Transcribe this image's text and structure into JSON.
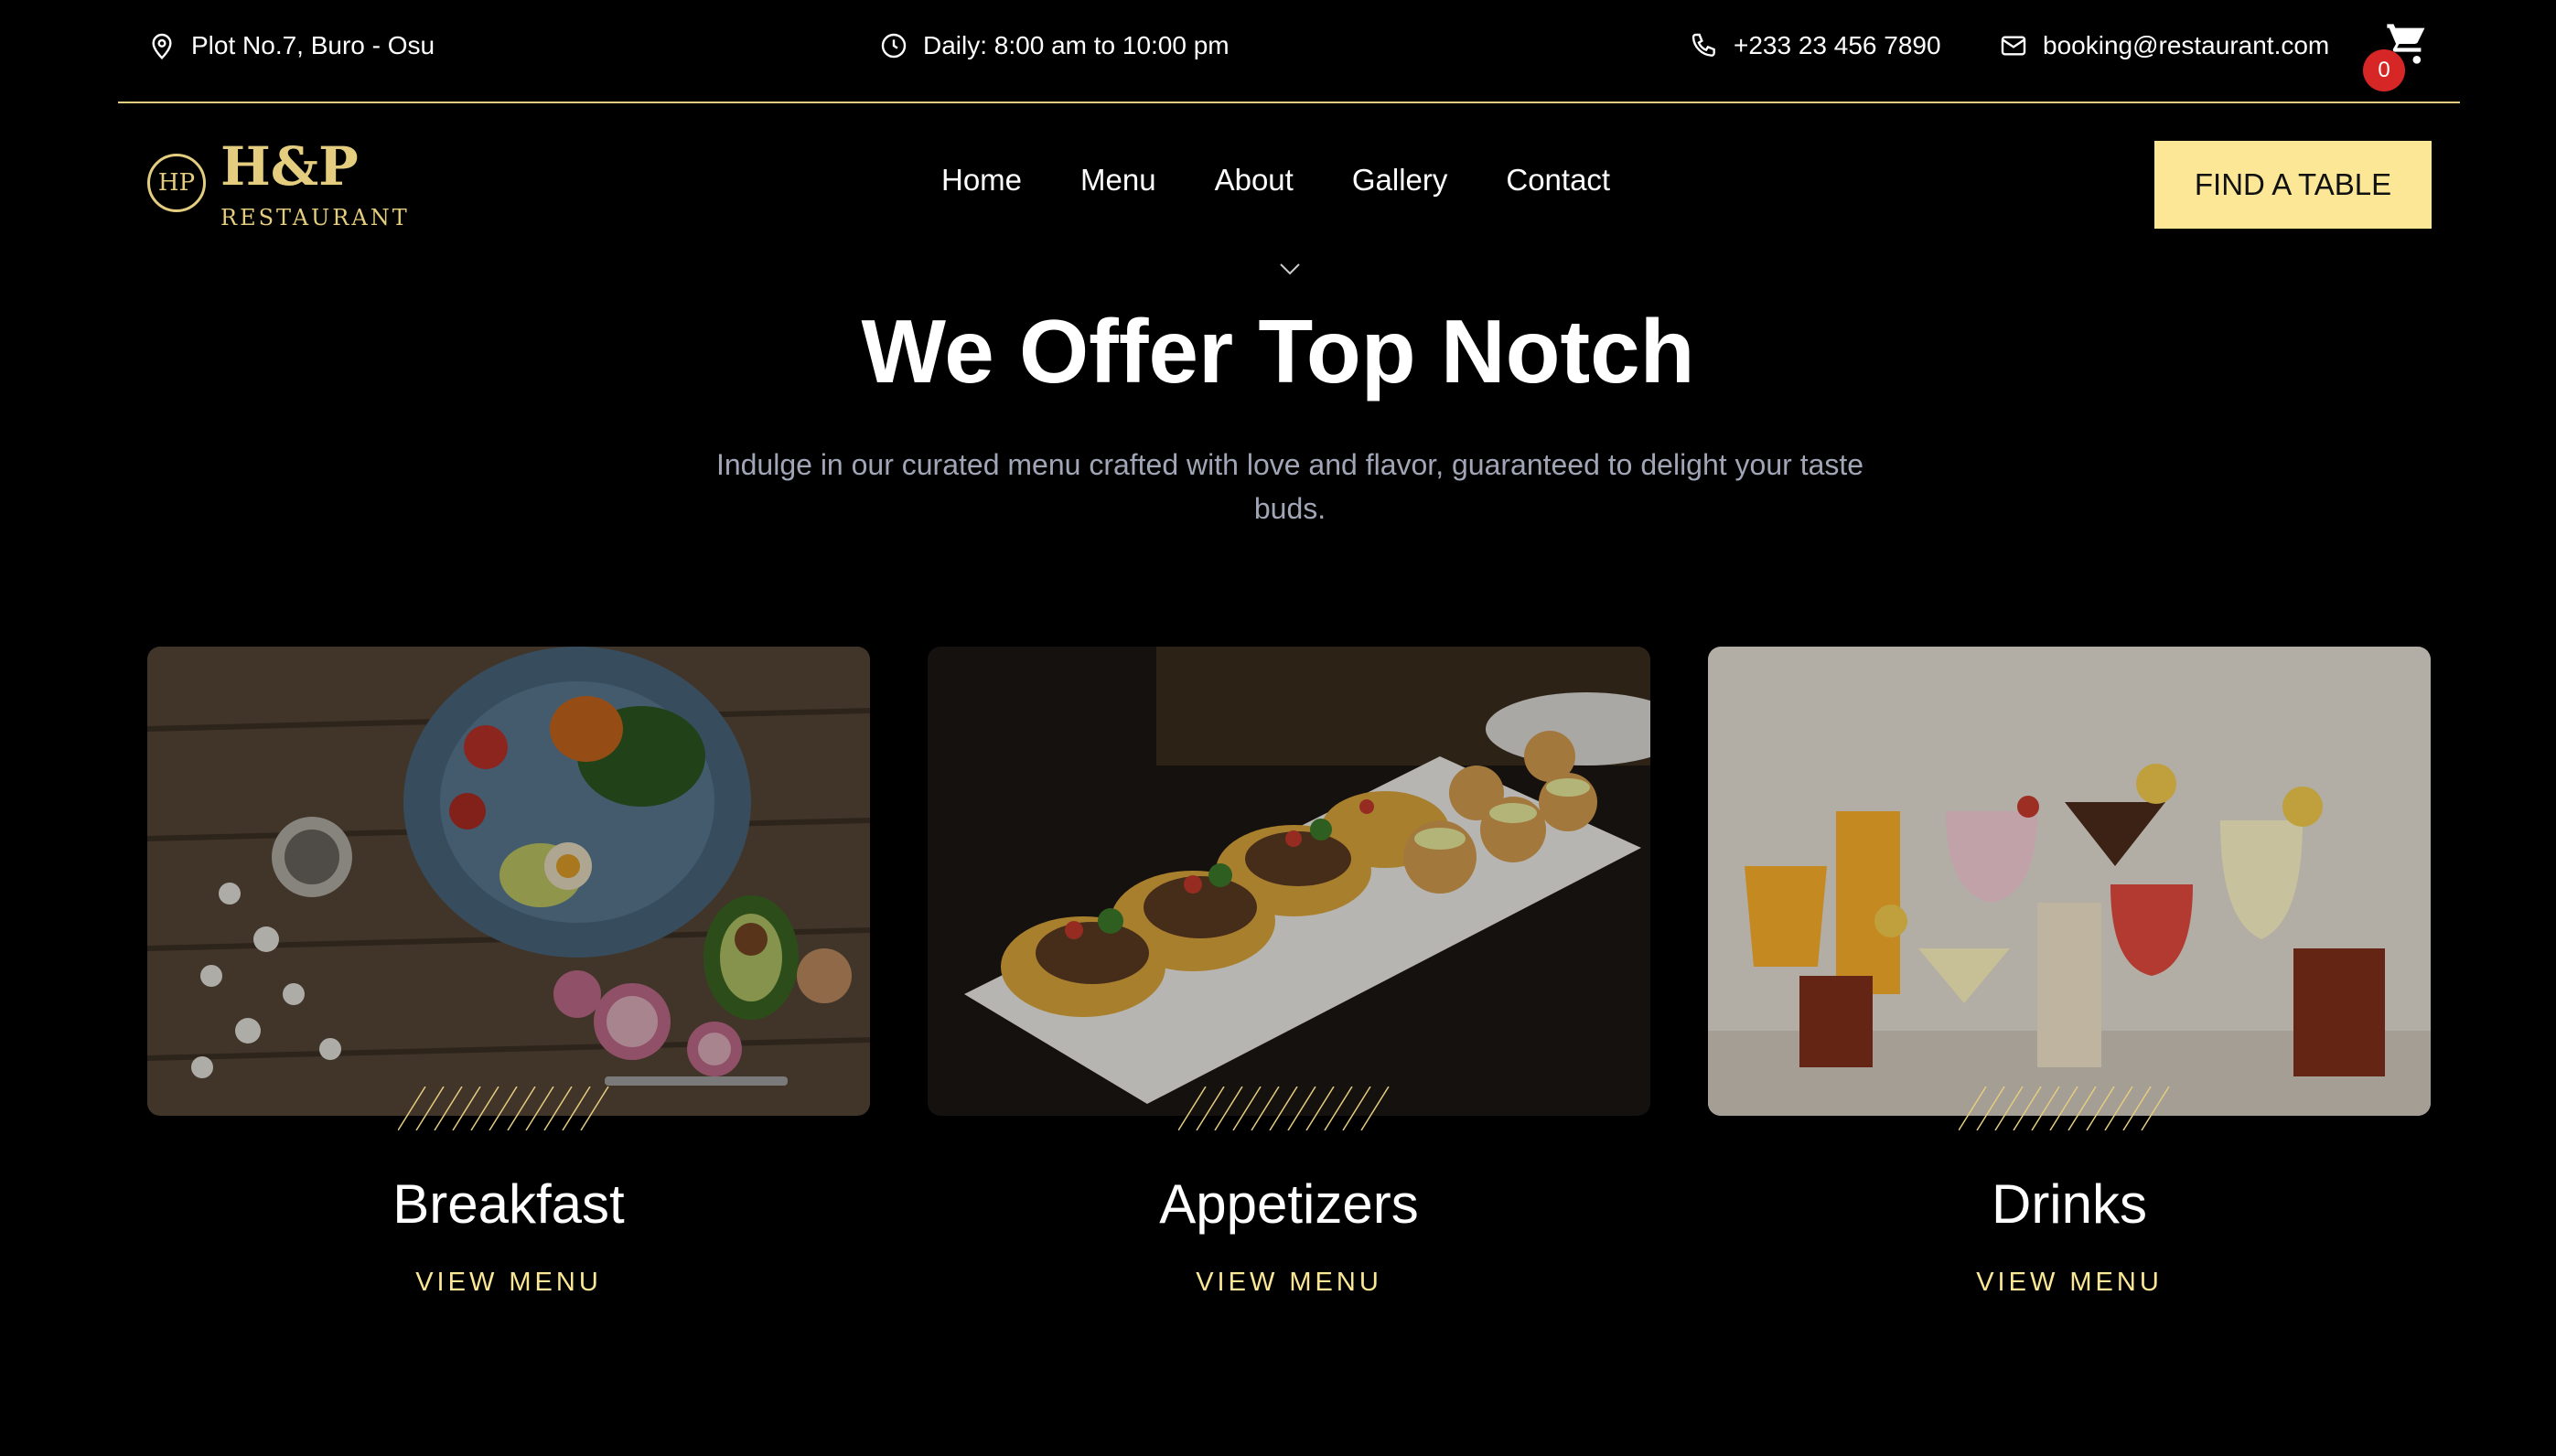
{
  "topbar": {
    "address": "Plot No.7, Buro - Osu",
    "hours": "Daily: 8:00 am to 10:00 pm",
    "phone": "+233 23 456 7890",
    "email": "booking@restaurant.com",
    "cart_count": "0",
    "icons": [
      "map-pin-icon",
      "clock-icon",
      "phone-icon",
      "mail-icon",
      "cart-icon"
    ]
  },
  "logo": {
    "monogram": "HP",
    "name": "H&P",
    "subtitle": "RESTAURANT"
  },
  "nav": {
    "items": [
      "Home",
      "Menu",
      "About",
      "Gallery",
      "Contact"
    ]
  },
  "cta": {
    "label": "FIND A TABLE"
  },
  "hero": {
    "title": "We Offer Top Notch",
    "subtitle": "Indulge in our curated menu crafted with love and flavor, guaranteed to delight your taste buds."
  },
  "cards": [
    {
      "title": "Breakfast",
      "link": "VIEW MENU"
    },
    {
      "title": "Appetizers",
      "link": "VIEW MENU"
    },
    {
      "title": "Drinks",
      "link": "VIEW MENU"
    }
  ],
  "colors": {
    "accent": "#e4cd7e",
    "button": "#fbe795",
    "badge": "#d72626",
    "background": "#000000",
    "muted": "#a0a6b6"
  }
}
